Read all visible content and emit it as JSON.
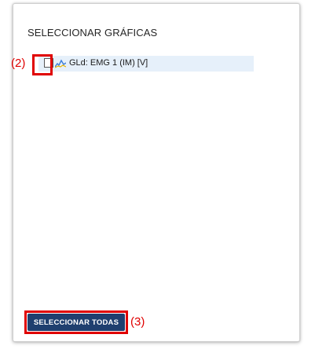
{
  "panel": {
    "title": "SELECCIONAR GRÁFICAS"
  },
  "graphs": [
    {
      "label": "GLd: EMG 1 (IM) [V]",
      "checked": false,
      "icon": "line-chart-icon"
    }
  ],
  "actions": {
    "select_all_label": "SELECCIONAR TODAS"
  },
  "annotations": {
    "checkbox_callout": "(2)",
    "button_callout": "(3)"
  },
  "colors": {
    "row_highlight": "#e6f0fa",
    "button_background": "#1f3f6f",
    "callout_red": "#e00000",
    "icon_blue": "#3b7dd8",
    "icon_yellow": "#e8b400"
  }
}
